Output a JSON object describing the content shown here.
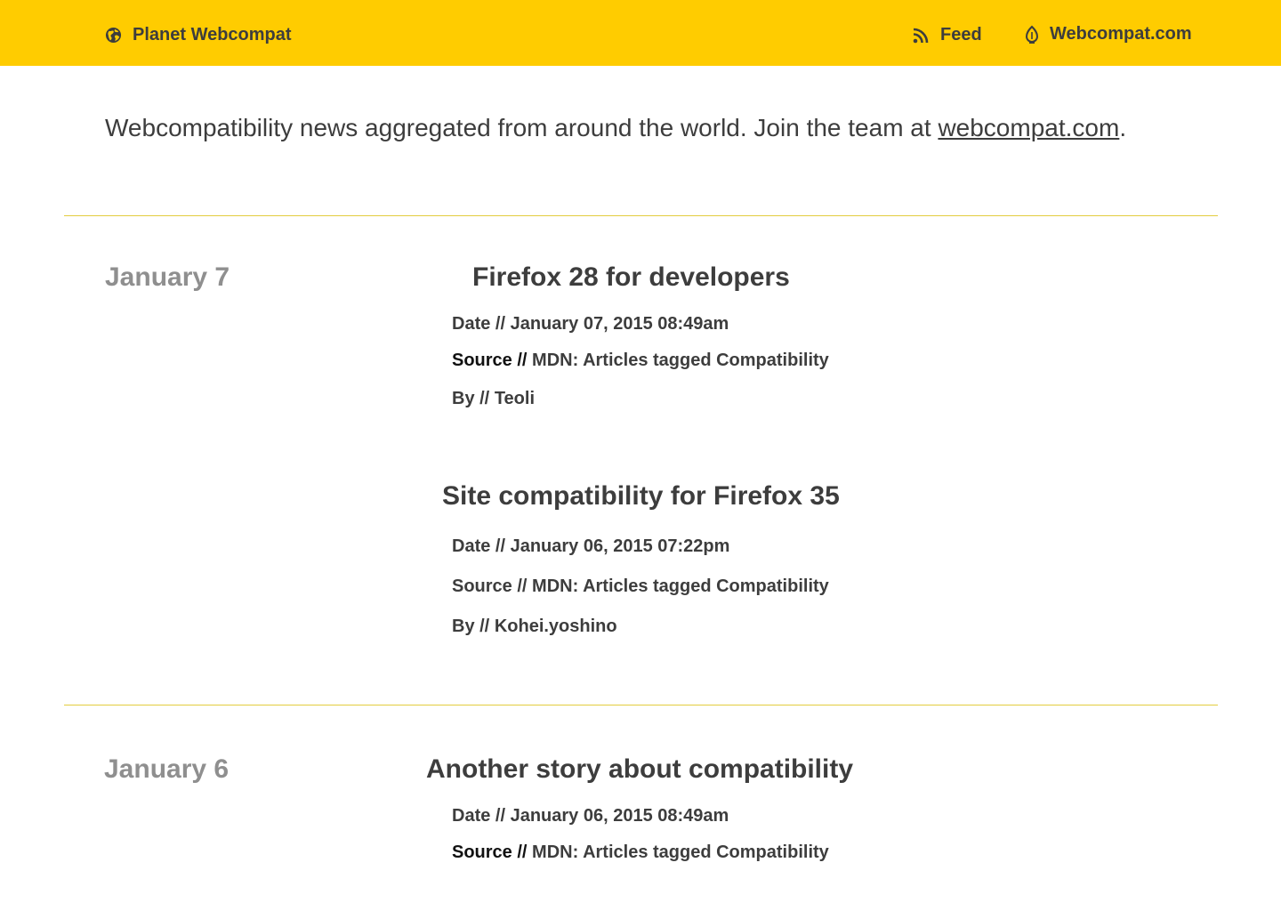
{
  "header": {
    "brand": "Planet Webcompat",
    "feed": "Feed",
    "site": "Webcompat.com"
  },
  "intro": {
    "text": "Webcompatibility news aggregated from around the world. Join the team at ",
    "link": "webcompat.com",
    "suffix": "."
  },
  "labels": {
    "date": "Date //",
    "source": "Source //",
    "by": "By //"
  },
  "days": [
    {
      "label": "January 7",
      "posts": [
        {
          "title": "Firefox 28 for developers",
          "date": "January 07, 2015 08:49am",
          "source": "MDN: Articles tagged Compatibility",
          "by": "Teoli"
        },
        {
          "title": "Site compatibility for Firefox 35",
          "date": "January 06, 2015 07:22pm",
          "source": "MDN: Articles tagged Compatibility",
          "by": "Kohei.yoshino"
        }
      ]
    },
    {
      "label": "January 6",
      "posts": [
        {
          "title": "Another story about compatibility",
          "date": "January 06, 2015 08:49am",
          "source": "MDN: Articles tagged Compatibility"
        }
      ]
    }
  ],
  "colors": {
    "header_bg": "#ffcc00",
    "text": "#3d3d3d",
    "day_label": "#8f8f8f",
    "divider": "#e3cd3f"
  },
  "icons": {
    "brand": "globe-icon",
    "feed": "rss-icon",
    "site": "bulb-icon"
  }
}
